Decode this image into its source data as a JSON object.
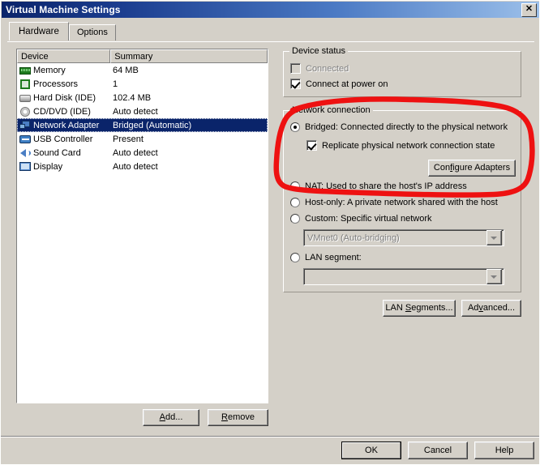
{
  "window": {
    "title": "Virtual Machine Settings",
    "close_label": "✕"
  },
  "tabs": [
    {
      "label": "Hardware",
      "active": true
    },
    {
      "label": "Options",
      "active": false
    }
  ],
  "device_list": {
    "columns": [
      "Device",
      "Summary"
    ],
    "rows": [
      {
        "icon": "memory-icon",
        "device": "Memory",
        "summary": "64 MB",
        "selected": false
      },
      {
        "icon": "processor-icon",
        "device": "Processors",
        "summary": "1",
        "selected": false
      },
      {
        "icon": "hard-disk-icon",
        "device": "Hard Disk (IDE)",
        "summary": "102.4 MB",
        "selected": false
      },
      {
        "icon": "cd-dvd-icon",
        "device": "CD/DVD (IDE)",
        "summary": "Auto detect",
        "selected": false
      },
      {
        "icon": "network-adapter-icon",
        "device": "Network Adapter",
        "summary": "Bridged (Automatic)",
        "selected": true
      },
      {
        "icon": "usb-controller-icon",
        "device": "USB Controller",
        "summary": "Present",
        "selected": false
      },
      {
        "icon": "sound-card-icon",
        "device": "Sound Card",
        "summary": "Auto detect",
        "selected": false
      },
      {
        "icon": "display-icon",
        "device": "Display",
        "summary": "Auto detect",
        "selected": false
      }
    ]
  },
  "list_buttons": {
    "add": "Add...",
    "remove": "Remove"
  },
  "device_status": {
    "title": "Device status",
    "connected": {
      "label": "Connected",
      "checked": false,
      "enabled": false
    },
    "connect_at_power_on": {
      "label": "Connect at power on",
      "checked": true,
      "enabled": true
    }
  },
  "network_connection": {
    "title": "Network connection",
    "options": [
      {
        "label": "Bridged: Connected directly to the physical network",
        "selected": true
      },
      {
        "label": "NAT: Used to share the host's IP address",
        "selected": false
      },
      {
        "label": "Host-only: A private network shared with the host",
        "selected": false
      },
      {
        "label": "Custom: Specific virtual network",
        "selected": false
      },
      {
        "label": "LAN segment:",
        "selected": false
      }
    ],
    "replicate_state": {
      "label": "Replicate physical network connection state",
      "checked": true
    },
    "configure_adapters": "Configure Adapters",
    "custom_network_value": "VMnet0 (Auto-bridging)",
    "lan_segment_value": ""
  },
  "side_buttons": {
    "lan_segments": "LAN Segments...",
    "advanced": "Advanced..."
  },
  "footer": {
    "ok": "OK",
    "cancel": "Cancel",
    "help": "Help"
  },
  "annotation": {
    "color": "#ee1111",
    "shape": "hand-drawn-red-oval"
  }
}
